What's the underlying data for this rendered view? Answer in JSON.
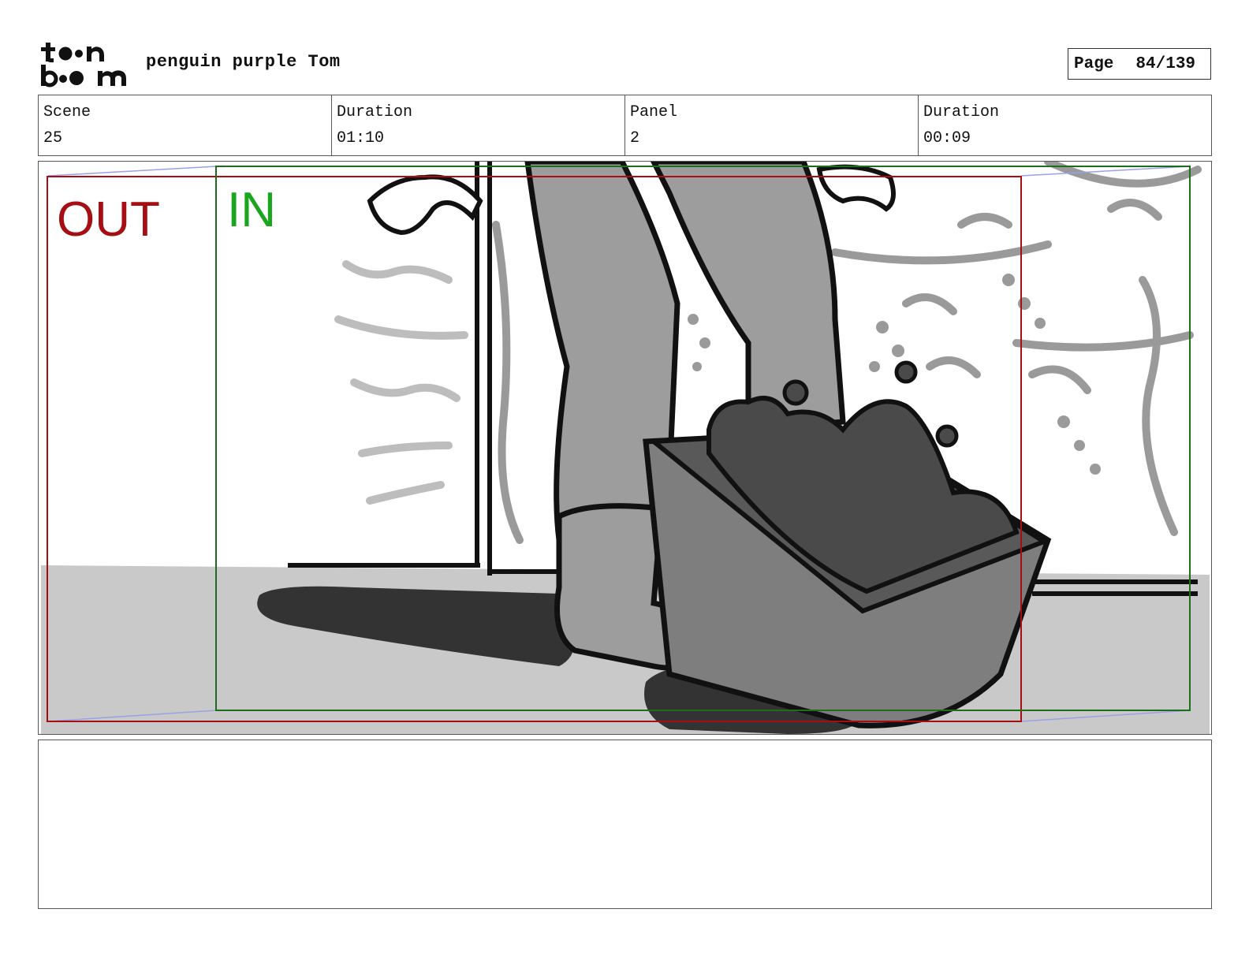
{
  "header": {
    "project_title": "penguin purple Tom",
    "page_label": "Page",
    "page_number": "84/139"
  },
  "logo": {
    "text_line1": "toon",
    "text_line2": "boom"
  },
  "info": {
    "scene_label": "Scene",
    "scene_value": "25",
    "scene_duration_label": "Duration",
    "scene_duration_value": "01:10",
    "panel_label": "Panel",
    "panel_value": "2",
    "panel_duration_label": "Duration",
    "panel_duration_value": "00:09"
  },
  "panel": {
    "out_label": "OUT",
    "in_label": "IN",
    "out_color": "#a50f13",
    "in_color": "#19a51d"
  },
  "notes": {
    "text": ""
  }
}
